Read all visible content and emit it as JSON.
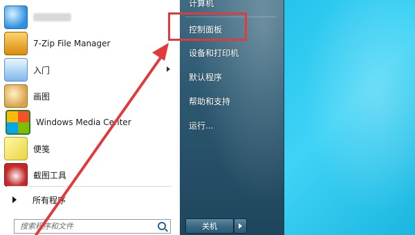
{
  "start_menu": {
    "programs": [
      {
        "name": "blurred-program",
        "label": "",
        "icon": "app-icon"
      },
      {
        "name": "7zip",
        "label": "7-Zip File Manager",
        "icon": "7zip-icon"
      },
      {
        "name": "getting-started",
        "label": "入门",
        "icon": "getting-started-icon",
        "has_submenu": true
      },
      {
        "name": "paint",
        "label": "画图",
        "icon": "paint-icon"
      },
      {
        "name": "wmc",
        "label": "Windows Media Center",
        "icon": "windows-media-center-icon"
      },
      {
        "name": "sticky-notes",
        "label": "便笺",
        "icon": "sticky-notes-icon"
      },
      {
        "name": "snipping-tool",
        "label": "截图工具",
        "icon": "snipping-tool-icon"
      }
    ],
    "all_programs": "所有程序",
    "search": {
      "placeholder": "搜索程序和文件"
    },
    "right_panel": {
      "computer": "计算机",
      "control_panel": "控制面板",
      "devices_printers": "设备和打印机",
      "default_programs": "默认程序",
      "help_support": "帮助和支持",
      "run": "运行..."
    },
    "shutdown_label": "关机"
  },
  "annotation": {
    "color": "#e23a3a"
  }
}
